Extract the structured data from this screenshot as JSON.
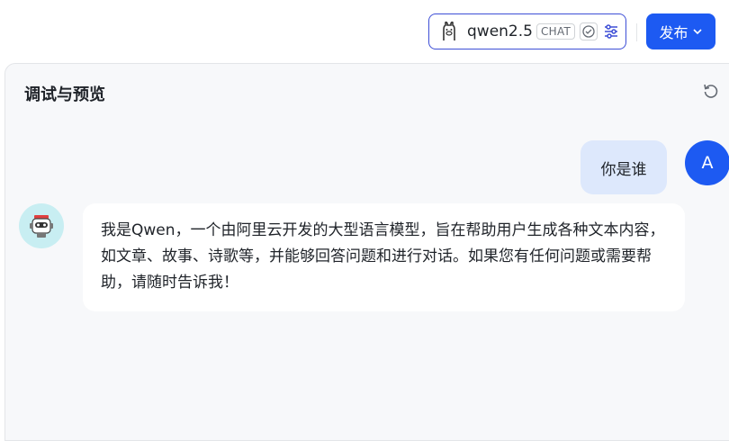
{
  "header": {
    "model": {
      "name": "qwen2.5",
      "tag": "CHAT",
      "logo_icon": "llama-icon"
    },
    "publish_label": "发布"
  },
  "panel": {
    "title": "调试与预览"
  },
  "chat": {
    "messages": [
      {
        "role": "user",
        "avatar": "A",
        "text": "你是谁"
      },
      {
        "role": "assistant",
        "avatar_icon": "robot-icon",
        "text": "我是Qwen，一个由阿里云开发的大型语言模型，旨在帮助用户生成各种文本内容，如文章、故事、诗歌等，并能够回答问题和进行对话。如果您有任何问题或需要帮助，请随时告诉我！"
      }
    ]
  },
  "colors": {
    "accent": "#1d5af2",
    "user_bubble": "#dde8fc",
    "panel_bg": "#f7f8fa",
    "bot_avatar_bg": "#c8eef2"
  }
}
